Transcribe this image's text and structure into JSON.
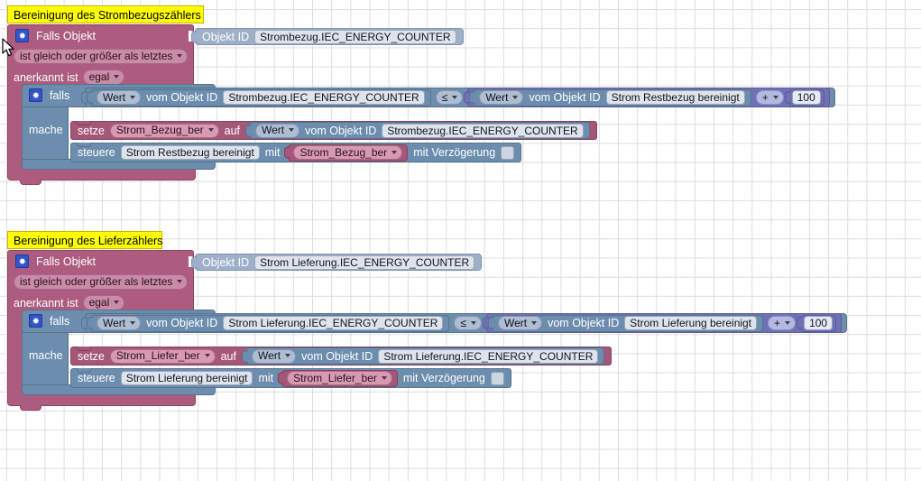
{
  "app": {
    "title": "Blockly Workspace",
    "background_color": "#ffffff",
    "grid_color": "#e2e2e2"
  },
  "colors": {
    "trigger_block": "#ad5b7e",
    "if_block": "#6c8dae",
    "object_id_block": "#9eb0c9",
    "math_block": "#6f71b4",
    "set_block": "#a5577a",
    "comment_label": "#ffff00"
  },
  "scripts": [
    {
      "id": "strombezug",
      "comment": "Bereinigung des Strombezugszählers",
      "trigger": {
        "gear_icon": "gear-icon",
        "title": "Falls Objekt",
        "object_id_label": "Objekt ID",
        "object_id_value": "Strombezug.IEC_ENERGY_COUNTER",
        "condition_dropdown": "ist gleich oder größer als letztes",
        "ack_label": "anerkannt ist",
        "ack_dropdown": "egal"
      },
      "if_block": {
        "gear_icon": "gear-icon",
        "if_label": "falls",
        "do_label": "mache",
        "condition": {
          "left": {
            "value_dropdown": "Wert",
            "from_label": "vom Objekt ID",
            "object_id": "Strombezug.IEC_ENERGY_COUNTER"
          },
          "operator": "≤",
          "right": {
            "value_dropdown": "Wert",
            "from_label": "vom Objekt ID",
            "object_id": "Strom Restbezug bereinigt",
            "math_operator": "+",
            "math_operand": "100"
          }
        },
        "statements": [
          {
            "type": "set-variable",
            "set_label": "setze",
            "variable": "Strom_Bezug_ber",
            "to_label": "auf",
            "value": {
              "value_dropdown": "Wert",
              "from_label": "vom Objekt ID",
              "object_id": "Strombezug.IEC_ENERGY_COUNTER"
            }
          },
          {
            "type": "control",
            "control_label": "steuere",
            "target": "Strom Restbezug bereinigt",
            "with_label": "mit",
            "variable": "Strom_Bezug_ber",
            "delay_label": "mit Verzögerung",
            "delay_checked": false
          }
        ]
      }
    },
    {
      "id": "lieferung",
      "comment": "Bereinigung des Lieferzählers",
      "trigger": {
        "gear_icon": "gear-icon",
        "title": "Falls Objekt",
        "object_id_label": "Objekt ID",
        "object_id_value": "Strom Lieferung.IEC_ENERGY_COUNTER",
        "condition_dropdown": "ist gleich oder größer als letztes",
        "ack_label": "anerkannt ist",
        "ack_dropdown": "egal"
      },
      "if_block": {
        "gear_icon": "gear-icon",
        "if_label": "falls",
        "do_label": "mache",
        "condition": {
          "left": {
            "value_dropdown": "Wert",
            "from_label": "vom Objekt ID",
            "object_id": "Strom Lieferung.IEC_ENERGY_COUNTER"
          },
          "operator": "≤",
          "right": {
            "value_dropdown": "Wert",
            "from_label": "vom Objekt ID",
            "object_id": "Strom Lieferung bereinigt",
            "math_operator": "+",
            "math_operand": "100"
          }
        },
        "statements": [
          {
            "type": "set-variable",
            "set_label": "setze",
            "variable": "Strom_Liefer_ber",
            "to_label": "auf",
            "value": {
              "value_dropdown": "Wert",
              "from_label": "vom Objekt ID",
              "object_id": "Strom Lieferung.IEC_ENERGY_COUNTER"
            }
          },
          {
            "type": "control",
            "control_label": "steuere",
            "target": "Strom Lieferung bereinigt",
            "with_label": "mit",
            "variable": "Strom_Liefer_ber",
            "delay_label": "mit Verzögerung",
            "delay_checked": false
          }
        ]
      }
    }
  ]
}
